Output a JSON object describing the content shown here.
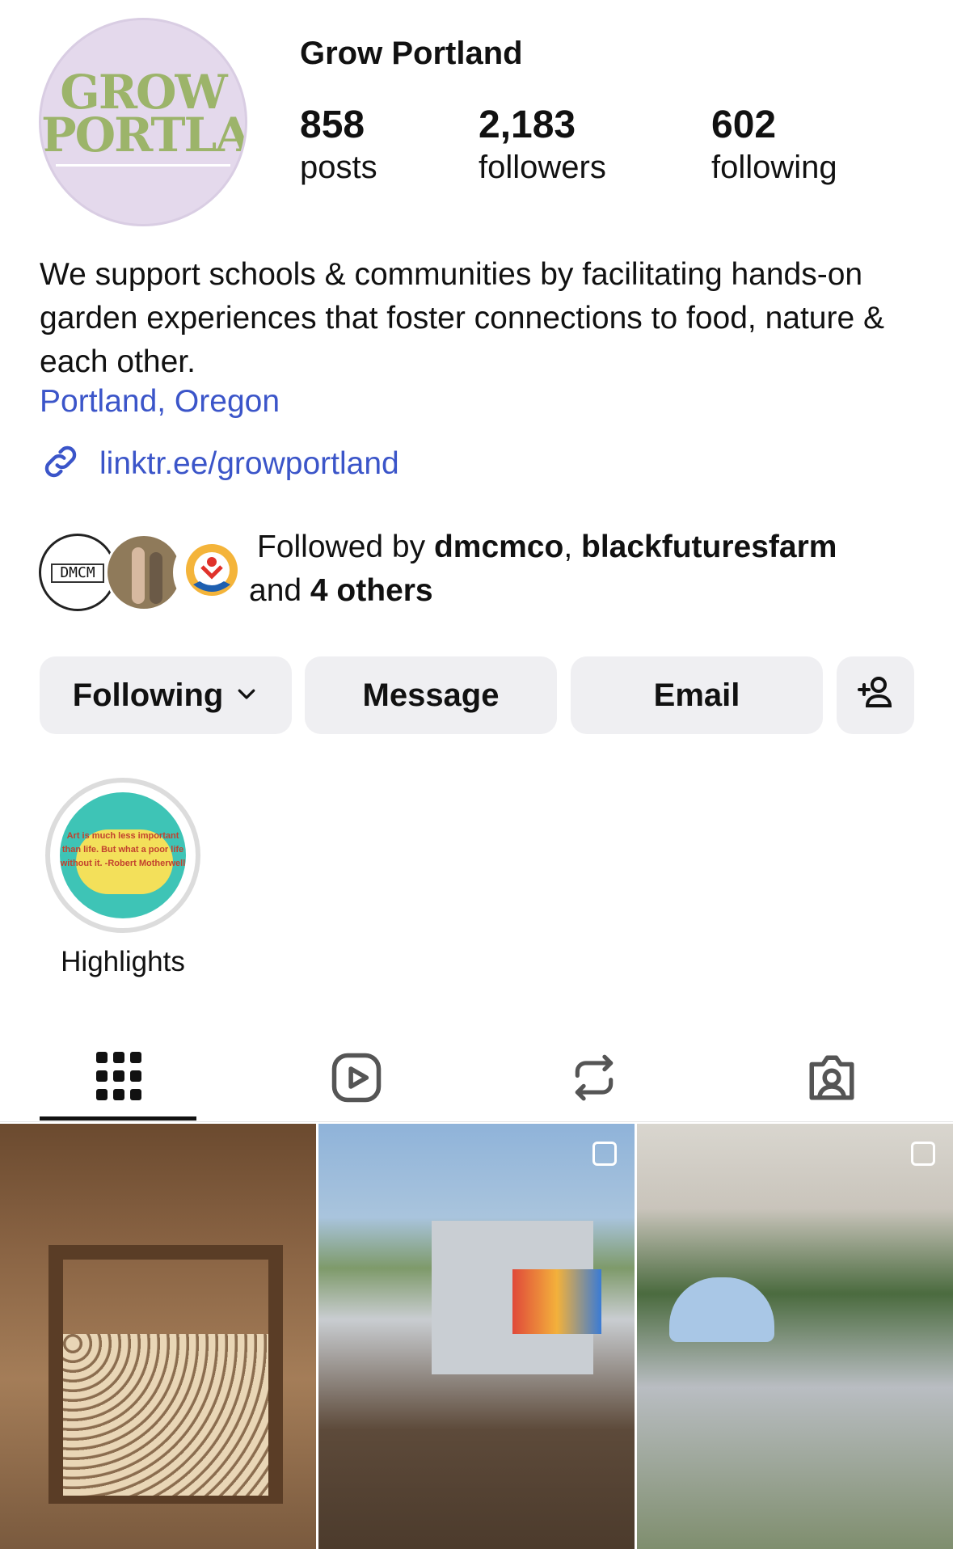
{
  "profile": {
    "name": "Grow Portland",
    "avatar_text_line1": "GROW",
    "avatar_text_line2": "PORTLAND",
    "stats": [
      {
        "value": "858",
        "label": "posts"
      },
      {
        "value": "2,183",
        "label": "followers"
      },
      {
        "value": "602",
        "label": "following"
      }
    ],
    "bio": "We support schools & communities by facilitating hands-on garden experiences that foster connections to food, nature & each other.",
    "location": "Portland, Oregon",
    "link": "linktr.ee/growportland"
  },
  "mutuals": {
    "avatar1_text": "DMCM",
    "prefix": "Followed by ",
    "user1": "dmcmco",
    "separator": ", ",
    "user2": "blackfuturesfarm",
    "and_text": " and ",
    "others": "4 others"
  },
  "actions": {
    "following_label": "Following",
    "message_label": "Message",
    "email_label": "Email"
  },
  "highlights": [
    {
      "label": "Highlights",
      "quote": "Art is much less important than life. But what a poor life without it. -Robert Motherwell"
    }
  ],
  "tabs": [
    {
      "icon": "grid-icon",
      "active": true
    },
    {
      "icon": "reels-icon",
      "active": false
    },
    {
      "icon": "reposts-icon",
      "active": false
    },
    {
      "icon": "tagged-icon",
      "active": false
    }
  ],
  "colors": {
    "link": "#3b55c9",
    "button_bg": "#efeff2",
    "avatar_bg": "#e4d9ec",
    "logo_green": "#9cb46a"
  }
}
